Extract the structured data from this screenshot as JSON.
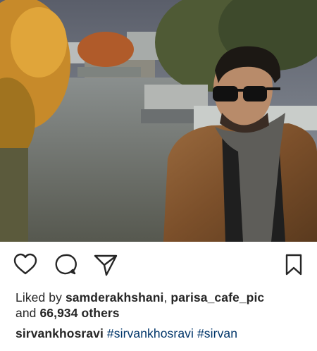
{
  "post": {
    "photo_alt": "sirvankhosravi post photo",
    "likes": {
      "prefix": "Liked by",
      "user1": "samderakhshani",
      "sep": ",",
      "user2": "parisa_cafe_pic",
      "and": "and",
      "count": "66,934 others"
    },
    "caption": {
      "username": "sirvankhosravi",
      "hashtags": [
        "#sirvankhosravi",
        "#sirvan"
      ]
    }
  },
  "icons": {
    "like": "heart-icon",
    "comment": "comment-icon",
    "share": "paper-plane-icon",
    "save": "bookmark-icon"
  },
  "colors": {
    "text": "#262626",
    "hashtag": "#003569"
  }
}
